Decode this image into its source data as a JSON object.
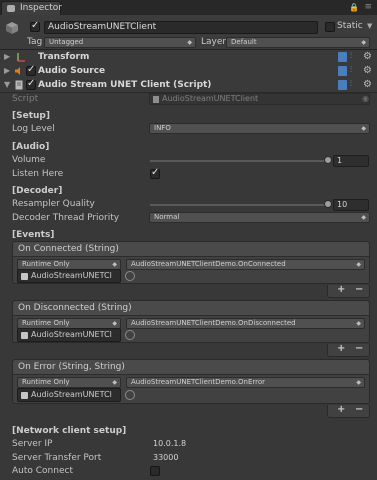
{
  "window": {
    "tab_label": "Inspector"
  },
  "header": {
    "object_name": "AudioStreamUNETClient",
    "static_label": "Static",
    "tag_label": "Tag",
    "tag_value": "Untagged",
    "layer_label": "Layer",
    "layer_value": "Default"
  },
  "components": [
    {
      "title": "Transform"
    },
    {
      "title": "Audio Source"
    },
    {
      "title": "Audio Stream UNET Client (Script)"
    }
  ],
  "script_field": {
    "label": "Script",
    "value": "AudioStreamUNETClient"
  },
  "setup": {
    "heading": "[Setup]",
    "log_level_label": "Log Level",
    "log_level_value": "INFO"
  },
  "audio": {
    "heading": "[Audio]",
    "volume_label": "Volume",
    "volume_value": "1",
    "volume_fraction": 1.0,
    "listen_here_label": "Listen Here",
    "listen_here_checked": true
  },
  "decoder": {
    "heading": "[Decoder]",
    "resampler_label": "Resampler Quality",
    "resampler_value": "10",
    "resampler_fraction": 1.0,
    "thread_priority_label": "Decoder Thread Priority",
    "thread_priority_value": "Normal"
  },
  "events": {
    "heading": "[Events]",
    "items": [
      {
        "title": "On Connected (String)",
        "mode": "Runtime Only",
        "function": "AudioStreamUNETClientDemo.OnConnected",
        "object": "AudioStreamUNETCl"
      },
      {
        "title": "On Disconnected (String)",
        "mode": "Runtime Only",
        "function": "AudioStreamUNETClientDemo.OnDisconnected",
        "object": "AudioStreamUNETCl"
      },
      {
        "title": "On Error (String, String)",
        "mode": "Runtime Only",
        "function": "AudioStreamUNETClientDemo.OnError",
        "object": "AudioStreamUNETCl"
      }
    ],
    "plus": "+",
    "minus": "−"
  },
  "network": {
    "heading": "[Network client setup]",
    "server_ip_label": "Server IP",
    "server_ip_value": "10.0.1.8",
    "port_label": "Server Transfer Port",
    "port_value": "33000",
    "auto_connect_label": "Auto Connect",
    "auto_connect_checked": false
  },
  "colors": {
    "book_icon": "#4a7fbf",
    "audio_icon": "#e07b1e",
    "transform_icon": "#8fb24a"
  }
}
